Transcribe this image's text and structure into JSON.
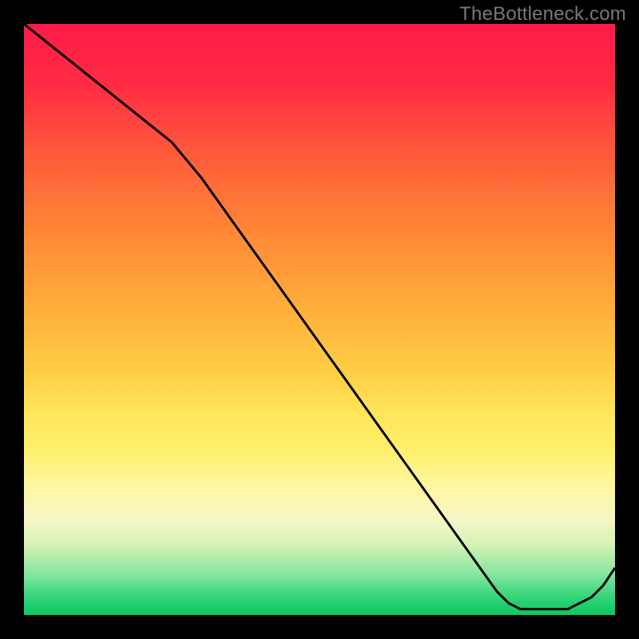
{
  "watermark": "TheBottleneck.com",
  "colors": {
    "top": "#ff1a48",
    "bottom": "#0cc760",
    "bg": "#000000",
    "line": "#000000"
  },
  "chart_data": {
    "type": "line",
    "title": "",
    "xlabel": "",
    "ylabel": "",
    "xlim": [
      0,
      100
    ],
    "ylim": [
      0,
      100
    ],
    "x": [
      0,
      5,
      10,
      15,
      20,
      25,
      30,
      35,
      40,
      45,
      50,
      55,
      60,
      65,
      70,
      75,
      80,
      82,
      84,
      86,
      88,
      90,
      92,
      94,
      96,
      98,
      100
    ],
    "y": [
      100,
      96,
      92,
      88,
      84,
      80,
      74,
      67,
      60,
      53,
      46,
      39,
      32,
      25,
      18,
      11,
      4,
      2,
      1,
      1,
      1,
      1,
      1,
      2,
      3,
      5,
      8
    ],
    "grid": false,
    "legend": false,
    "annotations": []
  }
}
